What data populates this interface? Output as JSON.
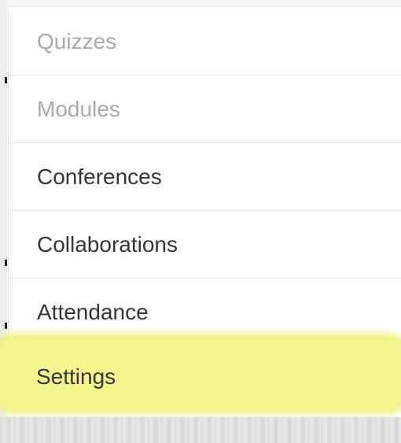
{
  "sidebar": {
    "items": [
      {
        "label": "Quizzes",
        "state": "disabled"
      },
      {
        "label": "Modules",
        "state": "disabled"
      },
      {
        "label": "Conferences",
        "state": "enabled"
      },
      {
        "label": "Collaborations",
        "state": "enabled"
      },
      {
        "label": "Attendance",
        "state": "enabled"
      },
      {
        "label": "Settings",
        "state": "highlighted"
      }
    ],
    "colors": {
      "enabled_text": "#363636",
      "disabled_text": "#a9a9a9",
      "highlight": "#f3f58c"
    }
  }
}
